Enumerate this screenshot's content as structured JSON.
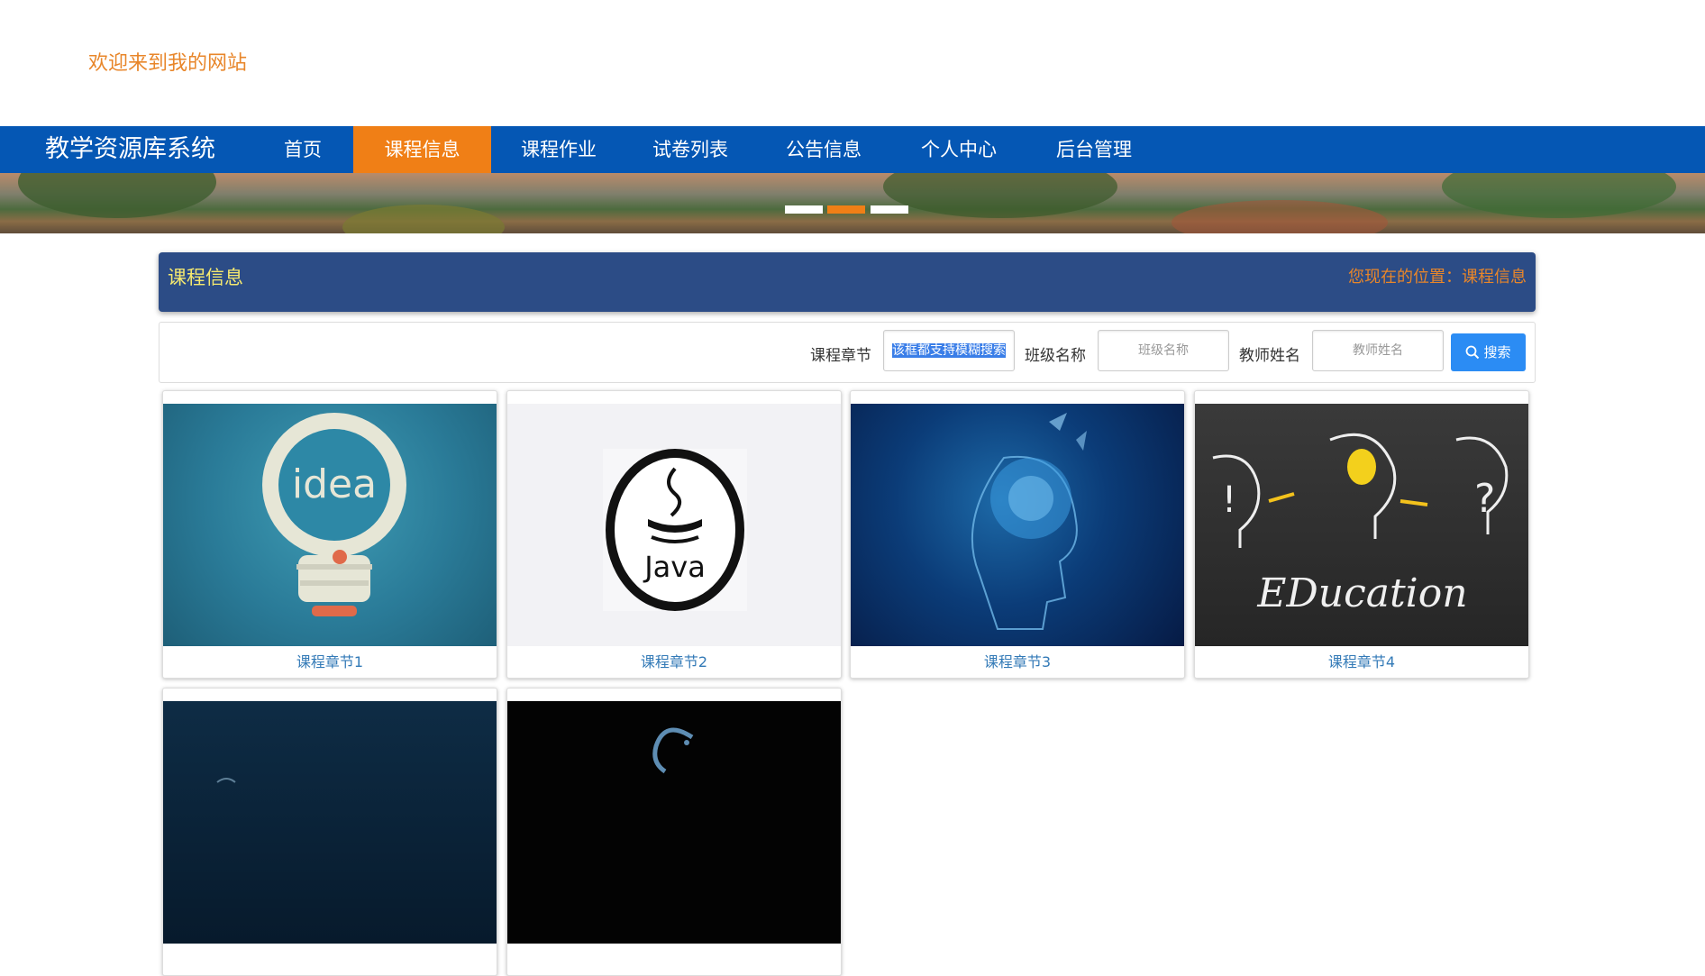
{
  "header": {
    "welcome": "欢迎来到我的网站"
  },
  "nav": {
    "brand": "教学资源库系统",
    "items": [
      "首页",
      "课程信息",
      "课程作业",
      "试卷列表",
      "公告信息",
      "个人中心",
      "后台管理"
    ],
    "active": "课程信息"
  },
  "banner": {
    "slide_count": 3,
    "active_slide": 2
  },
  "page": {
    "title": "课程信息",
    "breadcrumb": "您现在的位置：课程信息"
  },
  "search": {
    "fields": [
      {
        "label": "课程章节",
        "value": "该框都支持模糊搜索",
        "selected": true
      },
      {
        "label": "班级名称",
        "placeholder": "班级名称"
      },
      {
        "label": "教师姓名",
        "placeholder": "教师姓名"
      }
    ],
    "button_label": "搜索"
  },
  "cards": [
    {
      "title": "课程章节1",
      "image": "idea-lightbulb-gear"
    },
    {
      "title": "课程章节2",
      "image": "java-logo"
    },
    {
      "title": "课程章节3",
      "image": "ai-brain-head"
    },
    {
      "title": "课程章节4",
      "image": "education-chalkboard"
    },
    {
      "title": "",
      "image": "dark-blue-partial"
    },
    {
      "title": "",
      "image": "mysql-dolphin-partial"
    }
  ],
  "colors": {
    "nav_bg": "#0557b4",
    "accent": "#f07f16",
    "header_bg": "#2c4c86",
    "link": "#337ab7"
  }
}
